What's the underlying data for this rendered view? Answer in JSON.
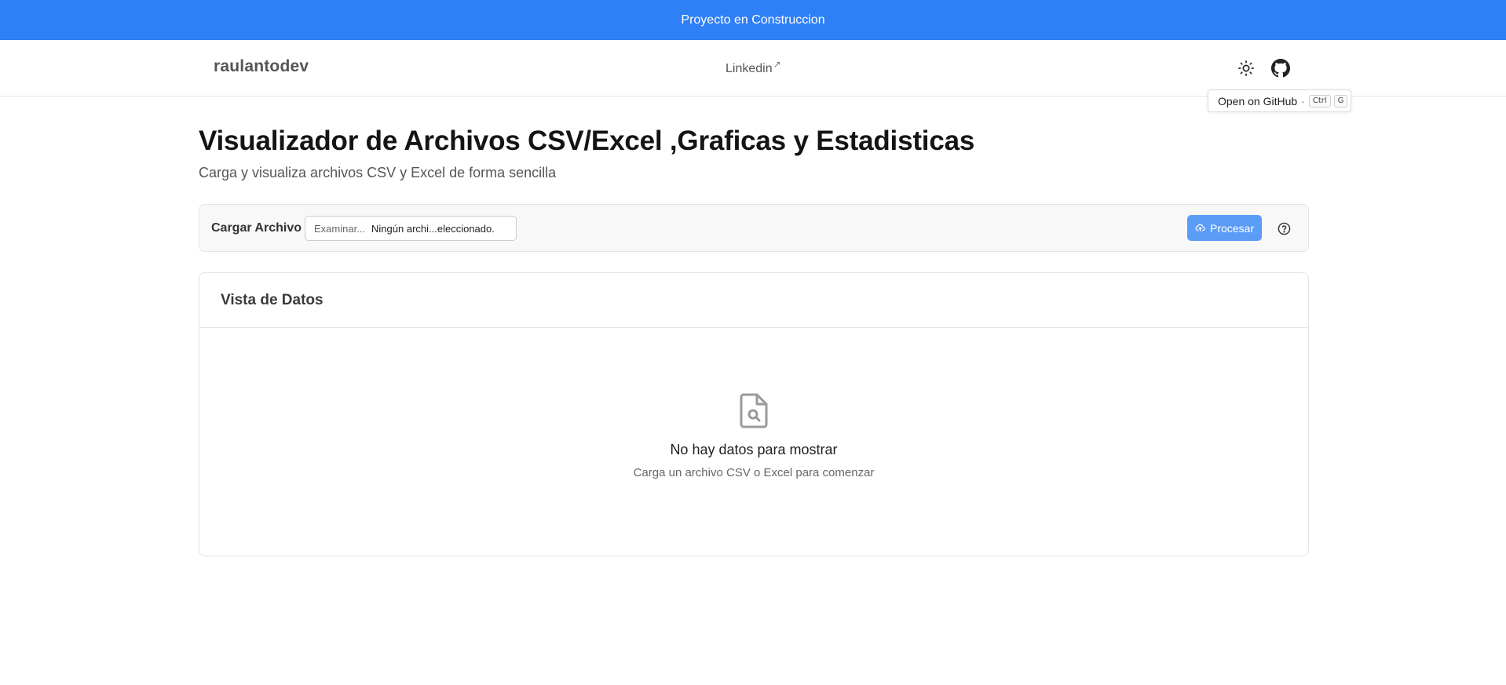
{
  "banner": {
    "text": "Proyecto en Construccion"
  },
  "navbar": {
    "brand": "raulantodev",
    "link_label": "Linkedin",
    "link_ext": "↗"
  },
  "tooltip": {
    "text": "Open on GitHub",
    "separator": "·",
    "keys": [
      "Ctrl",
      "G"
    ]
  },
  "page": {
    "title": "Visualizador de Archivos CSV/Excel ,Graficas y Estadisticas",
    "subtitle": "Carga y visualiza archivos CSV y Excel de forma sencilla"
  },
  "upload": {
    "label": "Cargar Archivo",
    "browse_label": "Examinar...",
    "file_name": "Ningún archi...eleccionado.",
    "process_label": "Procesar"
  },
  "data_view": {
    "title": "Vista de Datos",
    "empty_title": "No hay datos para mostrar",
    "empty_subtitle": "Carga un archivo CSV o Excel para comenzar"
  },
  "colors": {
    "banner": "#2f7ff6",
    "process_button": "#5b9cf7",
    "icon_gray": "#9a9a9a"
  },
  "icons": {
    "theme": "sun-icon",
    "github": "github-icon",
    "upload": "cloud-upload-icon",
    "help": "question-circle-icon",
    "empty": "file-search-icon"
  }
}
